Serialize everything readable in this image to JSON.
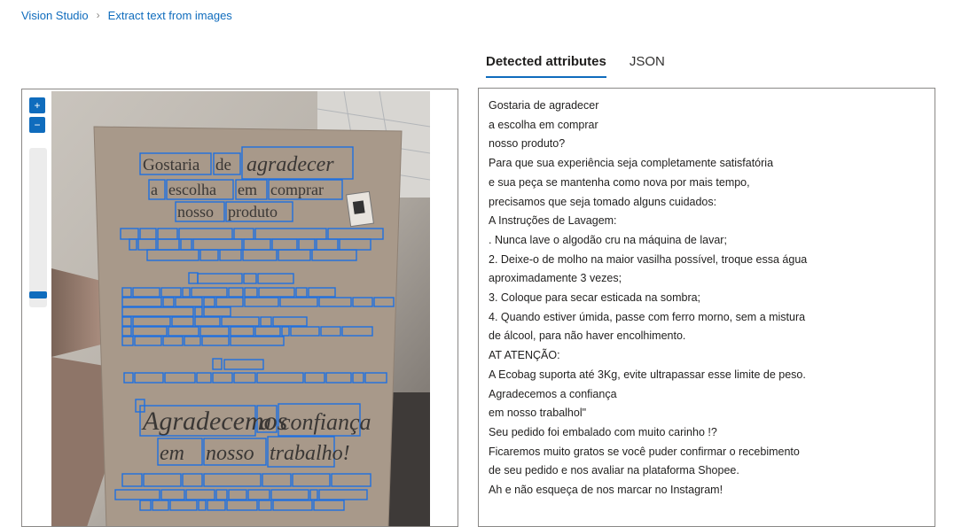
{
  "breadcrumb": {
    "root": "Vision Studio",
    "separator": "›",
    "current": "Extract text from images"
  },
  "viewer": {
    "zoom_in_icon": "plus-icon",
    "zoom_out_icon": "minus-icon",
    "zoom_in_label": "+",
    "zoom_out_label": "−",
    "image_description_word": "photo",
    "detected_words": {
      "title": [
        "Gostaria",
        "de",
        "agradecer"
      ],
      "line2": [
        "a",
        "escolha",
        "em",
        "comprar"
      ],
      "line3": [
        "nosso",
        "produto"
      ],
      "body1": [
        "Para",
        "que",
        "sua",
        "experiência",
        "seja",
        "completamente",
        "satisfatória"
      ],
      "body2": [
        "e",
        "sua",
        "peça",
        "se",
        "mantenha",
        "como",
        "nova",
        "por",
        "mais",
        "tempo,"
      ],
      "body3": [
        "precisamos",
        "que",
        "seja",
        "tomado",
        "alguns",
        "cuidados:"
      ],
      "instr": [
        "Instruções",
        "de",
        "Lavagem:"
      ],
      "i1": [
        "Nunca",
        "lave",
        "o",
        "algodão",
        "cru",
        "na",
        "máquina",
        "de",
        "lavar;"
      ],
      "i2": [
        "Deixe-o",
        "de",
        "molho",
        "na",
        "maior",
        "vasilha",
        "possível,",
        "troque",
        "essa",
        "água"
      ],
      "i3": [
        "aproximadamente",
        "3",
        "vezes;"
      ],
      "i4": [
        "Coloque",
        "para",
        "secar",
        "esticada",
        "na",
        "sombra;"
      ],
      "i5": [
        "Quando",
        "estiver",
        "úmida,",
        "passe",
        "com",
        "ferro",
        "morno,",
        "sem",
        "a",
        "mistura"
      ],
      "i6": [
        "de",
        "álcool,",
        "para",
        "não",
        "haver",
        "encolhimento."
      ],
      "att": [
        "ATENÇÃO:"
      ],
      "att1": [
        "A",
        "Ecobag",
        "suporta",
        "até",
        "3Kg,",
        "evite",
        "ultrapassar",
        "esse",
        "limite",
        "de",
        "peso."
      ],
      "big1": [
        "Agradecemos",
        "a",
        "confiança"
      ],
      "big2": [
        "em",
        "nosso",
        "trabalho!"
      ],
      "s1": [
        "Seu",
        "pedido",
        "foi",
        "embalado",
        "com",
        "muito",
        "carinho"
      ],
      "s2": [
        "Ficaremos",
        "muito",
        "gratos",
        "se",
        "você",
        "puder",
        "confirmar",
        "o",
        "recebimento"
      ],
      "s3": [
        "de",
        "seu",
        "pedido",
        "e",
        "nos",
        "avaliar",
        "na",
        "plataforma",
        "Shopee."
      ]
    }
  },
  "tabs": [
    {
      "label": "Detected attributes",
      "active": true
    },
    {
      "label": "JSON",
      "active": false
    }
  ],
  "detected_lines": [
    "Gostaria de agradecer",
    "a escolha em comprar",
    "nosso produto?",
    "Para que sua experiência seja completamente satisfatória",
    "e sua peça se mantenha como nova por mais tempo,",
    "precisamos que seja tomado alguns cuidados:",
    "A Instruções de Lavagem:",
    ". Nunca lave o algodão cru na máquina de lavar;",
    "2. Deixe-o de molho na maior vasilha possível, troque essa água",
    "aproximadamente 3 vezes;",
    "3. Coloque para secar esticada na sombra;",
    "4. Quando estiver úmida, passe com ferro morno, sem a mistura",
    "de álcool, para não haver encolhimento.",
    "AT ATENÇÃO:",
    "A Ecobag suporta até 3Kg, evite ultrapassar esse limite de peso.",
    "Agradecemos a confiança",
    "em nosso trabalhol\"",
    "Seu pedido foi embalado com muito carinho !?",
    "Ficaremos muito gratos se você puder confirmar o recebimento",
    "de seu pedido e nos avaliar na plataforma Shopee.",
    "Ah e não esqueça de nos marcar no Instagram!"
  ],
  "colors": {
    "accent": "#0f6cbd",
    "bbox": "#1e6fe0",
    "paper": "#a8998a"
  }
}
